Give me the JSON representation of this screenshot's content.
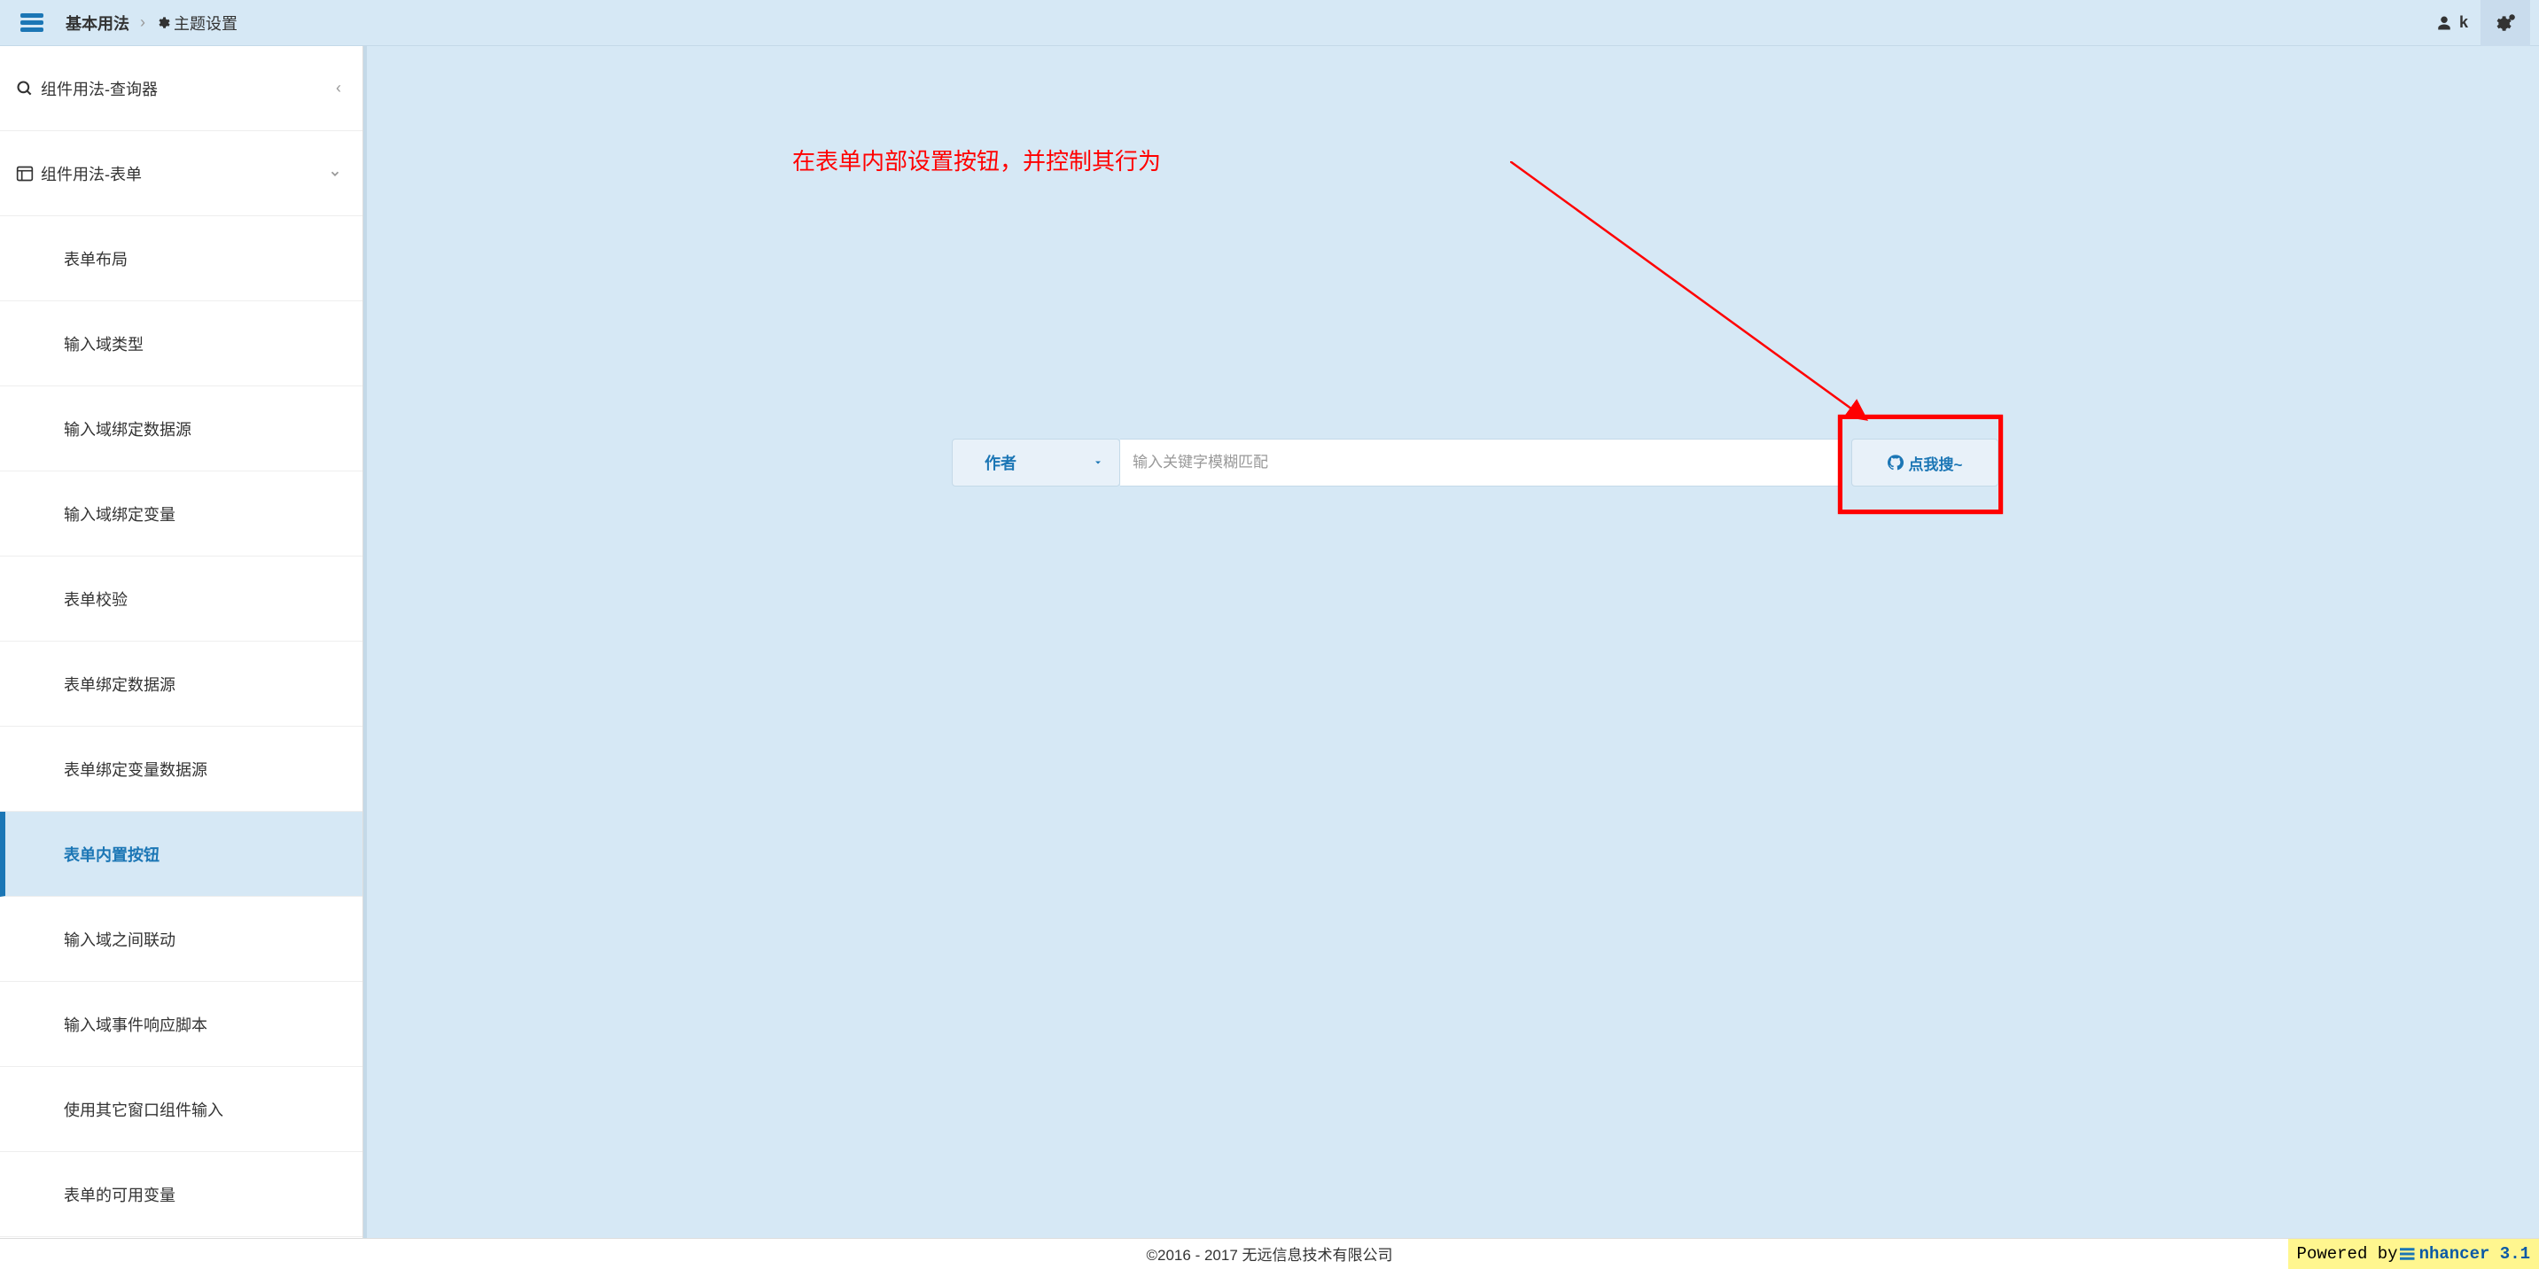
{
  "topbar": {
    "title": "基本用法",
    "theme_label": "主题设置",
    "user_label": "k"
  },
  "sidebar": {
    "group1": {
      "label": "组件用法-查询器"
    },
    "group2": {
      "label": "组件用法-表单"
    },
    "items": [
      "表单布局",
      "输入域类型",
      "输入域绑定数据源",
      "输入域绑定变量",
      "表单校验",
      "表单绑定数据源",
      "表单绑定变量数据源",
      "表单内置按钮",
      "输入域之间联动",
      "输入域事件响应脚本",
      "使用其它窗口组件输入",
      "表单的可用变量"
    ],
    "active_index": 7
  },
  "annotation": {
    "text": "在表单内部设置按钮，并控制其行为"
  },
  "form": {
    "dropdown_label": "作者",
    "input_placeholder": "输入关键字模糊匹配",
    "search_label": "点我搜~"
  },
  "footer": {
    "copyright": "©2016 - 2017 无远信息技术有限公司",
    "powered_prefix": "Powered by ",
    "powered_brand": "nhancer 3.1"
  }
}
